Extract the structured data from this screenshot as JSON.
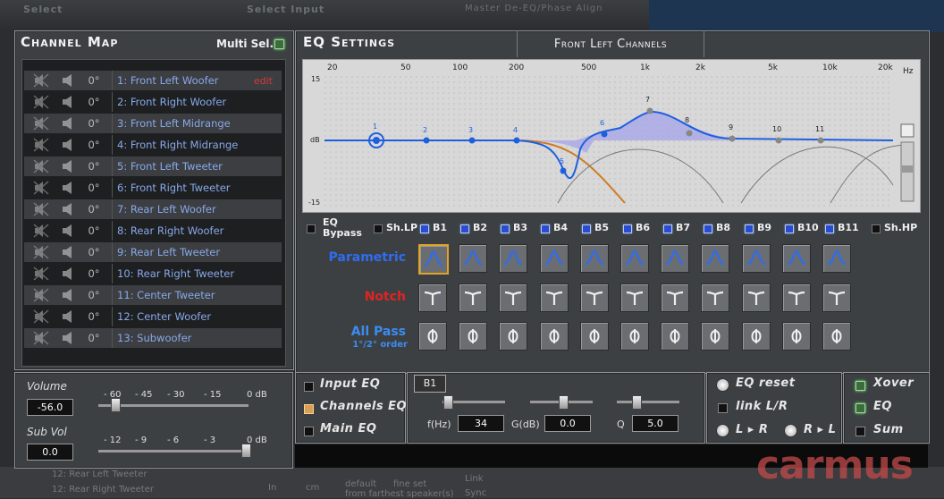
{
  "background": {
    "top_left": "Select",
    "top_mid": "Select Input",
    "top_mid2": "Master De-EQ/Phase Align",
    "bottom_items": [
      "12: Rear Left Tweeter",
      "12: Rear Right Tweeter",
      "In",
      "cm",
      "default",
      "fine set",
      "from farthest speaker(s)",
      "Link",
      "Sync"
    ]
  },
  "channel_map": {
    "title": "Channel Map",
    "multi_sel": "Multi Sel.",
    "channels": [
      {
        "deg": "0°",
        "label": "1: Front Left Woofer",
        "edit": "edit"
      },
      {
        "deg": "0°",
        "label": "2: Front Right Woofer"
      },
      {
        "deg": "0°",
        "label": "3: Front Left Midrange"
      },
      {
        "deg": "0°",
        "label": "4: Front Right Midrange"
      },
      {
        "deg": "0°",
        "label": "5: Front Left Tweeter"
      },
      {
        "deg": "0°",
        "label": "6: Front Right Tweeter"
      },
      {
        "deg": "0°",
        "label": "7: Rear Left Woofer"
      },
      {
        "deg": "0°",
        "label": "8: Rear Right Woofer"
      },
      {
        "deg": "0°",
        "label": "9: Rear Left Tweeter"
      },
      {
        "deg": "0°",
        "label": "10: Rear Right Tweeter"
      },
      {
        "deg": "0°",
        "label": "11: Center Tweeter"
      },
      {
        "deg": "0°",
        "label": "12: Center Woofer"
      },
      {
        "deg": "0°",
        "label": "13: Subwoofer"
      }
    ]
  },
  "eq": {
    "title": "EQ Settings",
    "channel_title": "Front Left Channels",
    "freq_ticks": [
      "20",
      "50",
      "100",
      "200",
      "500",
      "1k",
      "2k",
      "5k",
      "10k",
      "20k"
    ],
    "hz": "Hz",
    "db_top": "15",
    "db_mid": "dB",
    "db_bot": "-15",
    "points": [
      "1",
      "2",
      "3",
      "4",
      "5",
      "6",
      "7",
      "8",
      "9",
      "10",
      "11"
    ],
    "bypass": "EQ Bypass",
    "shlp": "Sh.LP",
    "shhp": "Sh.HP",
    "bands": [
      "B1",
      "B2",
      "B3",
      "B4",
      "B5",
      "B6",
      "B7",
      "B8",
      "B9",
      "B10",
      "B11"
    ],
    "parametric": "Parametric",
    "notch": "Notch",
    "allpass": "All Pass",
    "allpass_sub": "1°/2° order"
  },
  "volume": {
    "label": "Volume",
    "value": "-56.0",
    "scale": [
      "- 60",
      "- 45",
      "- 30",
      "- 15",
      "0 dB"
    ],
    "level_percent": 0
  },
  "subvol": {
    "label": "Sub Vol",
    "value": "0.0",
    "scale": [
      "- 12",
      "- 9",
      "- 6",
      "- 3",
      "0 dB"
    ],
    "level_percent": 100
  },
  "eq_mode": {
    "input": "Input EQ",
    "channels": "Channels EQ",
    "main": "Main EQ"
  },
  "band_edit": {
    "band": "B1",
    "f_label": "f(Hz)",
    "f_value": "34",
    "g_label": "G(dB)",
    "g_value": "0.0",
    "q_label": "Q",
    "q_value": "5.0"
  },
  "actions": {
    "reset": "EQ reset",
    "link": "link L/R",
    "lr": "L ▸ R",
    "rl": "R ▸ L"
  },
  "toggles": {
    "xover": "Xover",
    "eq": "EQ",
    "sum": "Sum"
  },
  "brand": "carmus",
  "colors": {
    "accent": "#1e5fe0",
    "notch": "#e02424",
    "allpass": "#3b8cf0"
  }
}
